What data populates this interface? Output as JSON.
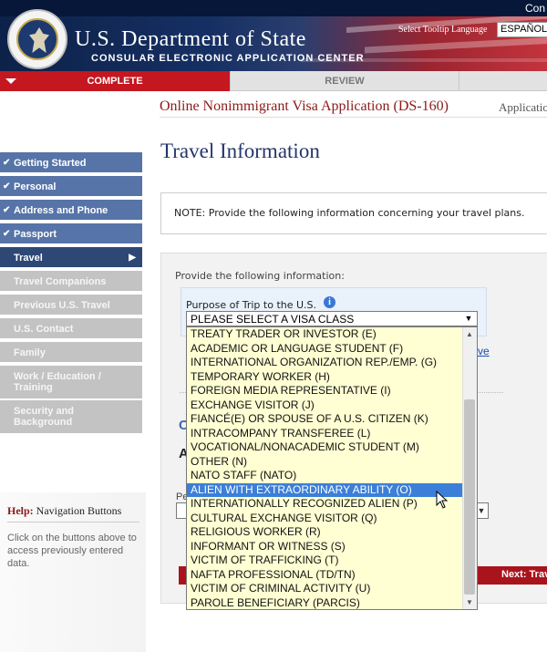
{
  "header": {
    "top_link": "Con",
    "title": "U.S. Department of State",
    "subtitle": "CONSULAR ELECTRONIC APPLICATION CENTER",
    "language_label": "Select Tooltip Language",
    "language_value": "ESPAÑOL"
  },
  "progress": {
    "complete_label": "COMPLETE",
    "review_label": "REVIEW"
  },
  "app": {
    "title": "Online Nonimmigrant Visa Application (DS-160)",
    "id_label": "Applicatio"
  },
  "page_title": "Travel Information",
  "sidebar": {
    "items": [
      {
        "label": "Getting Started",
        "state": "done"
      },
      {
        "label": "Personal",
        "state": "done"
      },
      {
        "label": "Address and Phone",
        "state": "done"
      },
      {
        "label": "Passport",
        "state": "done"
      },
      {
        "label": "Travel",
        "state": "current"
      },
      {
        "label": "Travel Companions",
        "state": "todo"
      },
      {
        "label": "Previous U.S. Travel",
        "state": "todo"
      },
      {
        "label": "U.S. Contact",
        "state": "todo"
      },
      {
        "label": "Family",
        "state": "todo"
      },
      {
        "label": "Work / Education / Training",
        "state": "todo"
      },
      {
        "label": "Security and Background",
        "state": "todo"
      }
    ],
    "check_glyph": "✔",
    "current_glyph": "▶"
  },
  "help": {
    "title_bold": "Help:",
    "title_rest": " Navigation Buttons",
    "text": "Click on the buttons above to access previously entered data."
  },
  "note": "NOTE: Provide the following information concerning your travel plans.",
  "form": {
    "provide": "Provide the following information:",
    "purpose_label": "Purpose of Trip to the U.S.",
    "info_glyph": "i",
    "visa_select_value": "PLEASE SELECT A VISA CLASS",
    "arrow_glyph": "▼",
    "background_link": "ve",
    "background_c": "C",
    "background_a": "A",
    "background_pe": "Pe",
    "next_label": "Next: Trav"
  },
  "dropdown": {
    "options": [
      "TREATY TRADER OR INVESTOR (E)",
      "ACADEMIC OR LANGUAGE STUDENT (F)",
      "INTERNATIONAL ORGANIZATION REP./EMP. (G)",
      "TEMPORARY WORKER (H)",
      "FOREIGN MEDIA REPRESENTATIVE (I)",
      "EXCHANGE VISITOR (J)",
      "FIANCÉ(E) OR SPOUSE OF A U.S. CITIZEN (K)",
      "INTRACOMPANY TRANSFEREE (L)",
      "VOCATIONAL/NONACADEMIC STUDENT (M)",
      "OTHER (N)",
      "NATO STAFF (NATO)",
      "ALIEN WITH EXTRAORDINARY ABILITY (O)",
      "INTERNATIONALLY RECOGNIZED ALIEN (P)",
      "CULTURAL EXCHANGE VISITOR (Q)",
      "RELIGIOUS WORKER (R)",
      "INFORMANT OR WITNESS (S)",
      "VICTIM OF TRAFFICKING (T)",
      "NAFTA PROFESSIONAL (TD/TN)",
      "VICTIM OF CRIMINAL ACTIVITY (U)",
      "PAROLE BENEFICIARY (PARCIS)"
    ],
    "highlighted_index": 11,
    "scroll_up_glyph": "▲",
    "scroll_down_glyph": "▼"
  },
  "colors": {
    "brand_red": "#c5171f",
    "nav_done": "#5674a8",
    "nav_current": "#2e4876",
    "nav_todo": "#c3c3c3",
    "dropdown_bg": "#ffffd3",
    "highlight": "#3b7fd8"
  }
}
